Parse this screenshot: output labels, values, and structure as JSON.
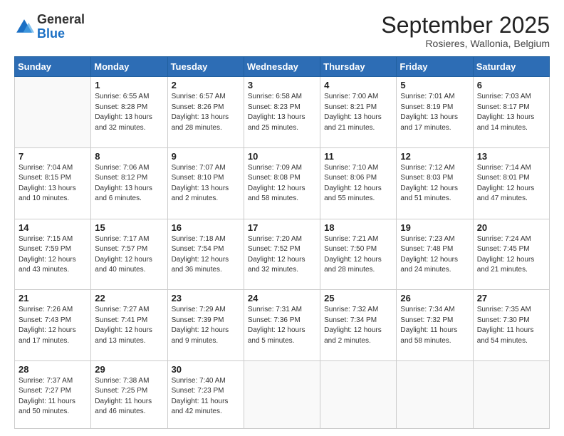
{
  "header": {
    "logo_general": "General",
    "logo_blue": "Blue",
    "month_title": "September 2025",
    "subtitle": "Rosieres, Wallonia, Belgium"
  },
  "days_of_week": [
    "Sunday",
    "Monday",
    "Tuesday",
    "Wednesday",
    "Thursday",
    "Friday",
    "Saturday"
  ],
  "weeks": [
    [
      {
        "num": "",
        "info": ""
      },
      {
        "num": "1",
        "info": "Sunrise: 6:55 AM\nSunset: 8:28 PM\nDaylight: 13 hours\nand 32 minutes."
      },
      {
        "num": "2",
        "info": "Sunrise: 6:57 AM\nSunset: 8:26 PM\nDaylight: 13 hours\nand 28 minutes."
      },
      {
        "num": "3",
        "info": "Sunrise: 6:58 AM\nSunset: 8:23 PM\nDaylight: 13 hours\nand 25 minutes."
      },
      {
        "num": "4",
        "info": "Sunrise: 7:00 AM\nSunset: 8:21 PM\nDaylight: 13 hours\nand 21 minutes."
      },
      {
        "num": "5",
        "info": "Sunrise: 7:01 AM\nSunset: 8:19 PM\nDaylight: 13 hours\nand 17 minutes."
      },
      {
        "num": "6",
        "info": "Sunrise: 7:03 AM\nSunset: 8:17 PM\nDaylight: 13 hours\nand 14 minutes."
      }
    ],
    [
      {
        "num": "7",
        "info": "Sunrise: 7:04 AM\nSunset: 8:15 PM\nDaylight: 13 hours\nand 10 minutes."
      },
      {
        "num": "8",
        "info": "Sunrise: 7:06 AM\nSunset: 8:12 PM\nDaylight: 13 hours\nand 6 minutes."
      },
      {
        "num": "9",
        "info": "Sunrise: 7:07 AM\nSunset: 8:10 PM\nDaylight: 13 hours\nand 2 minutes."
      },
      {
        "num": "10",
        "info": "Sunrise: 7:09 AM\nSunset: 8:08 PM\nDaylight: 12 hours\nand 58 minutes."
      },
      {
        "num": "11",
        "info": "Sunrise: 7:10 AM\nSunset: 8:06 PM\nDaylight: 12 hours\nand 55 minutes."
      },
      {
        "num": "12",
        "info": "Sunrise: 7:12 AM\nSunset: 8:03 PM\nDaylight: 12 hours\nand 51 minutes."
      },
      {
        "num": "13",
        "info": "Sunrise: 7:14 AM\nSunset: 8:01 PM\nDaylight: 12 hours\nand 47 minutes."
      }
    ],
    [
      {
        "num": "14",
        "info": "Sunrise: 7:15 AM\nSunset: 7:59 PM\nDaylight: 12 hours\nand 43 minutes."
      },
      {
        "num": "15",
        "info": "Sunrise: 7:17 AM\nSunset: 7:57 PM\nDaylight: 12 hours\nand 40 minutes."
      },
      {
        "num": "16",
        "info": "Sunrise: 7:18 AM\nSunset: 7:54 PM\nDaylight: 12 hours\nand 36 minutes."
      },
      {
        "num": "17",
        "info": "Sunrise: 7:20 AM\nSunset: 7:52 PM\nDaylight: 12 hours\nand 32 minutes."
      },
      {
        "num": "18",
        "info": "Sunrise: 7:21 AM\nSunset: 7:50 PM\nDaylight: 12 hours\nand 28 minutes."
      },
      {
        "num": "19",
        "info": "Sunrise: 7:23 AM\nSunset: 7:48 PM\nDaylight: 12 hours\nand 24 minutes."
      },
      {
        "num": "20",
        "info": "Sunrise: 7:24 AM\nSunset: 7:45 PM\nDaylight: 12 hours\nand 21 minutes."
      }
    ],
    [
      {
        "num": "21",
        "info": "Sunrise: 7:26 AM\nSunset: 7:43 PM\nDaylight: 12 hours\nand 17 minutes."
      },
      {
        "num": "22",
        "info": "Sunrise: 7:27 AM\nSunset: 7:41 PM\nDaylight: 12 hours\nand 13 minutes."
      },
      {
        "num": "23",
        "info": "Sunrise: 7:29 AM\nSunset: 7:39 PM\nDaylight: 12 hours\nand 9 minutes."
      },
      {
        "num": "24",
        "info": "Sunrise: 7:31 AM\nSunset: 7:36 PM\nDaylight: 12 hours\nand 5 minutes."
      },
      {
        "num": "25",
        "info": "Sunrise: 7:32 AM\nSunset: 7:34 PM\nDaylight: 12 hours\nand 2 minutes."
      },
      {
        "num": "26",
        "info": "Sunrise: 7:34 AM\nSunset: 7:32 PM\nDaylight: 11 hours\nand 58 minutes."
      },
      {
        "num": "27",
        "info": "Sunrise: 7:35 AM\nSunset: 7:30 PM\nDaylight: 11 hours\nand 54 minutes."
      }
    ],
    [
      {
        "num": "28",
        "info": "Sunrise: 7:37 AM\nSunset: 7:27 PM\nDaylight: 11 hours\nand 50 minutes."
      },
      {
        "num": "29",
        "info": "Sunrise: 7:38 AM\nSunset: 7:25 PM\nDaylight: 11 hours\nand 46 minutes."
      },
      {
        "num": "30",
        "info": "Sunrise: 7:40 AM\nSunset: 7:23 PM\nDaylight: 11 hours\nand 42 minutes."
      },
      {
        "num": "",
        "info": ""
      },
      {
        "num": "",
        "info": ""
      },
      {
        "num": "",
        "info": ""
      },
      {
        "num": "",
        "info": ""
      }
    ]
  ]
}
